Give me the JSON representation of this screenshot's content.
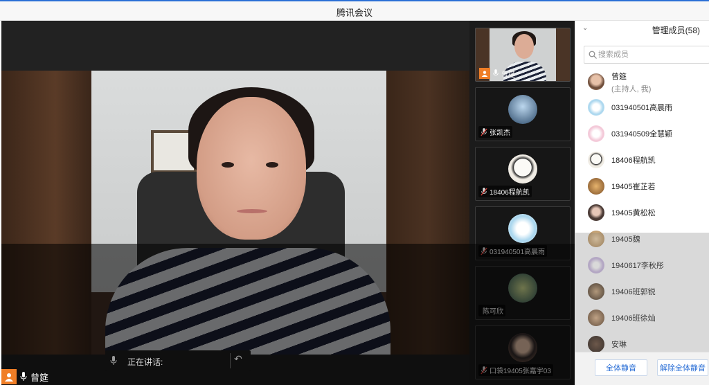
{
  "window": {
    "title": "腾讯会议"
  },
  "main_video": {
    "speaker_name": "曾筵",
    "speaking_label": "正在讲话:"
  },
  "tiles": [
    {
      "name": "曾筵",
      "icon": "host-icon"
    },
    {
      "name": "张凯杰",
      "icon": "muted-mic-icon",
      "avatar_color": "#7aa3c9"
    },
    {
      "name": "18406程航凯",
      "icon": "muted-mic-icon",
      "avatar_color": "#e9e4dc"
    },
    {
      "name": "031940501高晨雨",
      "icon": "muted-mic-icon",
      "avatar_color": "#cfe6f2"
    },
    {
      "name": "陈可欣",
      "icon": "",
      "avatar_color": "#6c8a6a"
    },
    {
      "name": "口袋19405张嘉宇03",
      "icon": "muted-mic-icon",
      "avatar_color": "#3b3b3b"
    }
  ],
  "panel": {
    "title": "管理成员(58)",
    "search_placeholder": "搜索成员",
    "members": [
      {
        "name": "曾筵",
        "sub": "(主持人, 我)",
        "avatar_color": "#a87c5a"
      },
      {
        "name": "031940501高晨雨",
        "avatar_color": "#cfe6f2"
      },
      {
        "name": "031940509全慧颖",
        "avatar_color": "#f3c7d7"
      },
      {
        "name": "18406程航凯",
        "avatar_color": "#e9e4dc"
      },
      {
        "name": "19405崔芷若",
        "avatar_color": "#9b6a3b"
      },
      {
        "name": "19405黄松松",
        "avatar_color": "#4a3a35"
      },
      {
        "name": "19405魏",
        "avatar_color": "#c8a26f"
      },
      {
        "name": "1940617李秋彤",
        "avatar_color": "#c9b7e0"
      },
      {
        "name": "19406班郭锐",
        "avatar_color": "#5b4630"
      },
      {
        "name": "19406班徐灿",
        "avatar_color": "#7a5a3e"
      },
      {
        "name": "安琳",
        "avatar_color": "#3a2a20"
      }
    ],
    "mute_all": "全体静音",
    "unmute_all": "解除全体静音"
  }
}
